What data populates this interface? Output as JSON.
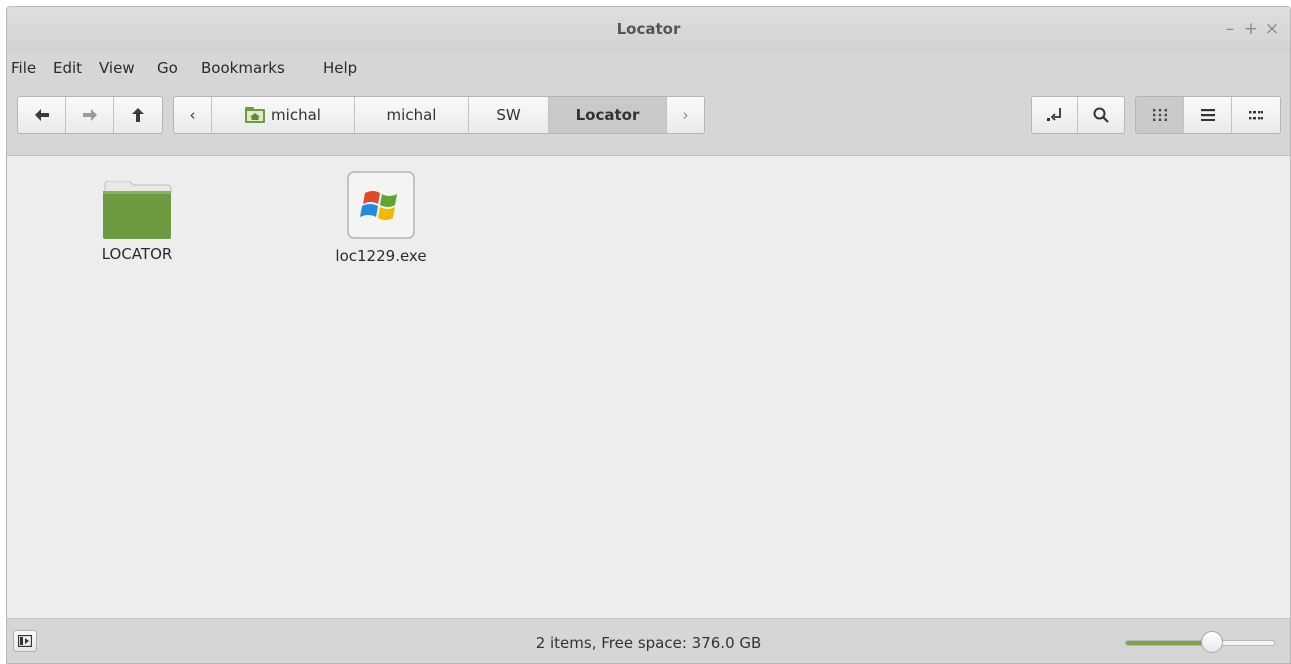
{
  "window": {
    "title": "Locator",
    "controls": {
      "minimize": "–",
      "maximize": "+",
      "close": "×"
    }
  },
  "menubar": {
    "items": [
      "File",
      "Edit",
      "View",
      "Go",
      "Bookmarks",
      "Help"
    ]
  },
  "toolbar": {
    "nav": {
      "back_icon": "arrow-left-icon",
      "forward_icon": "arrow-right-icon",
      "up_icon": "arrow-up-icon"
    },
    "path_prev_label": "‹",
    "path_next_label": "›",
    "path": [
      {
        "label": "michal",
        "icon": "home-folder-icon"
      },
      {
        "label": "michal"
      },
      {
        "label": "SW"
      },
      {
        "label": "Locator",
        "active": true
      }
    ],
    "tools": {
      "location_toggle": "location-entry-icon",
      "search": "search-icon"
    },
    "views": {
      "icon_view": "icon-view-icon",
      "list_view": "list-view-icon",
      "compact_view": "compact-view-icon"
    }
  },
  "files": [
    {
      "name": "LOCATOR",
      "type": "folder",
      "icon": "folder-icon"
    },
    {
      "name": "loc1229.exe",
      "type": "executable",
      "icon": "windows-executable-icon"
    }
  ],
  "statusbar": {
    "text": "2 items, Free space: 376.0 GB",
    "zoom_level": 0.58
  },
  "colors": {
    "accent": "#7ea24d",
    "background": "#ededed",
    "chrome": "#d6d6d6"
  }
}
